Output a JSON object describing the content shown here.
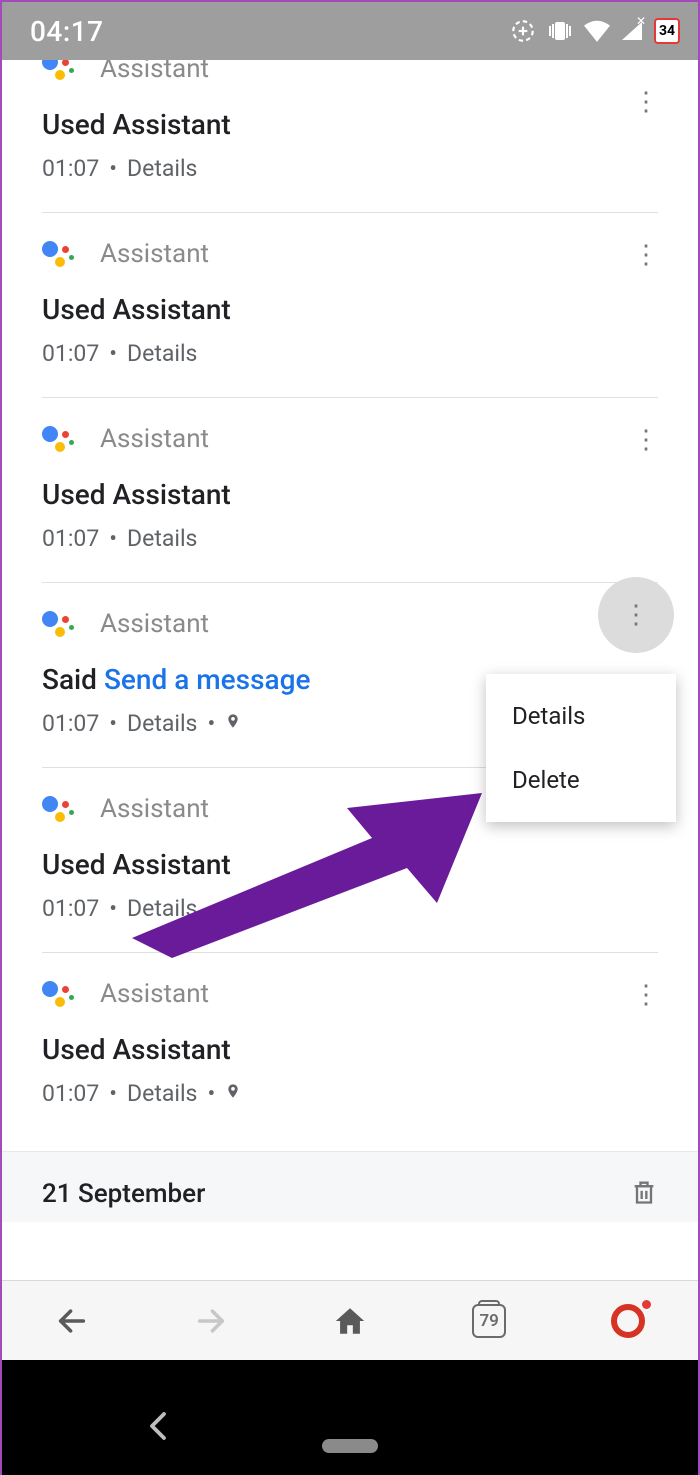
{
  "status_bar": {
    "time": "04:17",
    "calendar_day": "34"
  },
  "entries": [
    {
      "source": "Assistant",
      "title_plain": "Used Assistant",
      "time": "01:07",
      "details": "Details",
      "has_location": false
    },
    {
      "source": "Assistant",
      "title_plain": "Used Assistant",
      "time": "01:07",
      "details": "Details",
      "has_location": false
    },
    {
      "source": "Assistant",
      "title_plain": "Used Assistant",
      "time": "01:07",
      "details": "Details",
      "has_location": false
    },
    {
      "source": "Assistant",
      "title_said_prefix": "Said",
      "title_link": "Send a message",
      "time": "01:07",
      "details": "Details",
      "has_location": true,
      "menu_open": true
    },
    {
      "source": "Assistant",
      "title_plain": "Used Assistant",
      "time": "01:07",
      "details": "Details",
      "has_location": false
    },
    {
      "source": "Assistant",
      "title_plain": "Used Assistant",
      "time": "01:07",
      "details": "Details",
      "has_location": true
    }
  ],
  "popup_menu": {
    "details": "Details",
    "delete": "Delete"
  },
  "date_header": {
    "label": "21 September"
  },
  "browser_nav": {
    "tab_count": "79"
  }
}
